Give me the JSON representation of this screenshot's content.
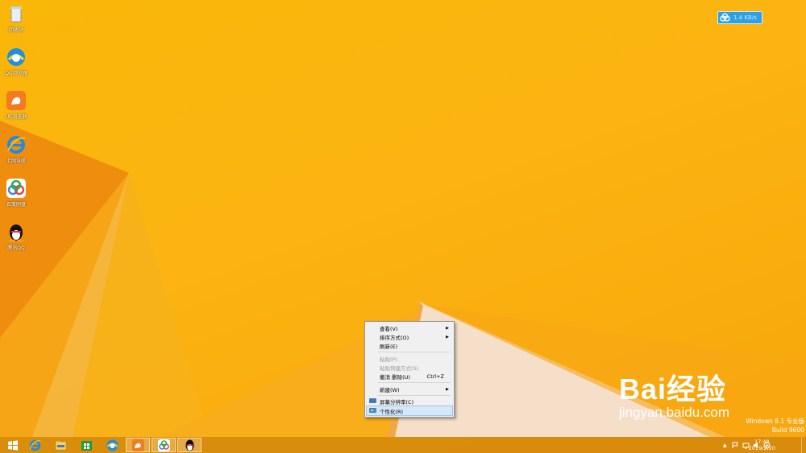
{
  "desktop": {
    "icons": [
      {
        "label": "回收站",
        "icon": "recycle-bin-icon"
      },
      {
        "label": "QQ浏览器",
        "icon": "qq-browser-icon"
      },
      {
        "label": "UC浏览器",
        "icon": "uc-browser-icon"
      },
      {
        "label": "上网导航",
        "icon": "ie-icon"
      },
      {
        "label": "百度网盘",
        "icon": "baidu-netdisk-icon"
      },
      {
        "label": "腾讯QQ",
        "icon": "qq-penguin-icon"
      }
    ]
  },
  "speed_widget": {
    "text": "1.4 KB/s",
    "icon": "baidu-netdisk-icon"
  },
  "context_menu": {
    "view": "查看(V)",
    "sort": "排序方式(O)",
    "refresh": "刷新(E)",
    "paste": "粘贴(P)",
    "paste_shortcut": "粘贴快捷方式(S)",
    "undo": "撤消 删除(U)",
    "undo_shortcut": "Ctrl+Z",
    "new": "新建(W)",
    "screen_resolution": "屏幕分辨率(C)",
    "personalize": "个性化(R)"
  },
  "taskbar": {
    "apps": [
      "start-icon",
      "ie-icon",
      "file-explorer-icon",
      "store-icon",
      "qq-browser-icon",
      "uc-browser-icon",
      "baidu-netdisk-icon",
      "qq-penguin-icon"
    ],
    "time": "17:48",
    "date": "2019/2/20"
  },
  "os_watermark": {
    "line1": "Windows 8.1 专业版",
    "line2": "Build 9600"
  },
  "baidu_watermark": {
    "logo": "Bai经验",
    "url": "jingyan.baidu.com"
  },
  "colors": {
    "wallpaper": "#f9b708",
    "accent": "#e8740a",
    "menu_bg": "#f0f0f0",
    "highlight": "#d5e8f8"
  }
}
